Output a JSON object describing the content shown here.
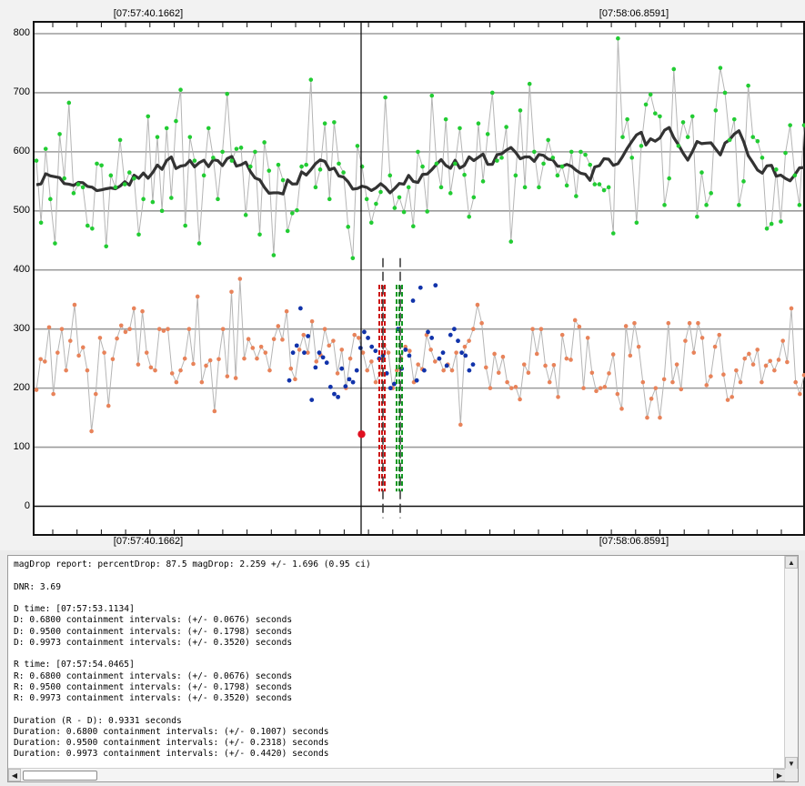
{
  "plot": {
    "top_left_time": "[07:57:40.1662]",
    "top_right_time": "[07:58:06.8591]",
    "bottom_left_time": "[07:57:40.1662]",
    "bottom_right_time": "[07:58:06.8591]",
    "yticks": [
      "800",
      "700",
      "600",
      "500",
      "400",
      "300",
      "200",
      "100",
      "0"
    ],
    "colors": {
      "comparison_points": "#22cc33",
      "target_points": "#e8835a",
      "selected_points": "#1133aa",
      "smooth_curve": "#333333",
      "trace_line": "#b5b5b5",
      "d_marker": "#cc1111",
      "r_marker": "#119922",
      "cursor_point": "#e01020"
    }
  },
  "chart_data": {
    "type": "scatter",
    "ylim": [
      0,
      800
    ],
    "grid": true,
    "series": [
      {
        "name": "",
        "values": [
          585,
          480,
          605,
          520,
          445,
          630,
          555,
          683,
          530,
          545,
          540,
          475,
          470,
          580,
          577,
          440,
          560,
          540,
          620,
          545,
          565,
          555,
          460,
          520,
          660,
          515,
          625,
          500,
          640,
          522,
          652,
          705,
          475,
          625,
          585,
          445,
          560,
          640,
          590,
          520,
          600,
          698,
          585,
          605,
          607,
          493,
          575,
          600,
          460,
          616,
          568,
          425,
          578,
          552,
          466,
          496,
          501,
          575,
          578,
          722,
          540,
          570,
          648,
          520,
          650,
          580,
          565,
          473,
          420,
          610,
          575,
          520,
          480,
          512,
          532,
          692,
          560,
          505,
          523,
          498,
          540,
          474,
          600,
          575,
          499,
          695,
          580,
          540,
          655,
          530,
          580,
          640,
          561,
          490,
          523,
          648,
          550,
          630,
          700,
          585,
          590,
          642,
          448,
          560,
          670,
          540,
          715,
          600,
          540,
          580,
          620,
          590,
          560,
          575,
          543,
          600,
          525,
          600,
          595,
          578,
          545,
          545,
          535,
          540,
          462,
          792,
          625,
          655,
          590,
          480,
          610,
          680,
          697,
          665,
          660,
          510,
          555,
          740,
          610,
          650,
          625,
          660,
          490,
          565,
          510,
          530,
          670,
          742,
          700,
          620,
          655,
          510,
          550,
          712,
          625,
          618,
          590,
          470,
          478,
          570,
          482,
          598,
          645,
          560,
          510,
          645
        ]
      },
      {
        "name": "",
        "values": [
          197,
          249,
          245,
          303,
          190,
          260,
          300,
          230,
          280,
          341,
          255,
          269,
          230,
          127,
          190,
          285,
          260,
          170,
          249,
          284,
          306,
          295,
          300,
          335,
          240,
          330,
          260,
          235,
          230,
          300,
          297,
          300,
          225,
          210,
          230,
          250,
          300,
          241,
          355,
          210,
          238,
          247,
          161,
          249,
          300,
          220,
          363,
          217,
          385,
          250,
          283,
          268,
          250,
          270,
          260,
          230,
          283,
          305,
          282,
          330,
          233,
          215,
          265,
          290,
          260,
          313,
          245,
          256,
          300,
          272,
          280,
          225,
          265,
          200,
          250,
          290,
          285,
          260,
          230,
          245,
          210,
          225,
          273,
          260,
          200,
          230,
          250,
          270,
          263,
          210,
          240,
          232,
          290,
          265,
          245,
          250,
          230,
          240,
          230,
          260,
          138,
          270,
          280,
          300,
          341,
          310,
          235,
          200,
          258,
          226,
          253,
          210,
          200,
          202,
          181,
          240,
          226,
          300,
          258,
          300,
          238,
          210,
          239,
          185,
          290,
          250,
          248,
          315,
          304,
          200,
          285,
          226,
          195,
          200,
          202,
          225,
          257,
          190,
          165,
          305,
          255,
          310,
          270,
          210,
          150,
          182,
          200,
          150,
          215,
          310,
          210,
          240,
          198,
          280,
          310,
          260,
          310,
          285,
          205,
          220,
          270,
          290,
          223,
          180,
          185,
          230,
          210,
          250,
          258,
          240,
          265,
          210,
          238,
          246,
          230,
          248,
          280,
          244,
          335,
          210,
          190,
          222
        ]
      },
      {
        "name": "",
        "values": [
          213,
          260,
          272,
          335,
          260,
          288,
          180,
          235,
          260,
          252,
          243,
          202,
          190,
          185,
          233,
          203,
          215,
          210,
          230,
          268,
          295,
          285,
          270,
          263,
          250,
          255,
          225,
          200,
          207,
          300,
          233,
          265,
          255,
          348,
          213,
          370,
          230,
          295,
          285,
          374,
          250,
          260,
          238,
          290,
          300,
          280,
          260,
          255,
          230,
          240
        ]
      }
    ]
  },
  "report": {
    "lines": [
      "magDrop report: percentDrop: 87.5 magDrop: 2.259 +/- 1.696 (0.95 ci)",
      "",
      "DNR: 3.69",
      "",
      "D time: [07:57:53.1134]",
      "D: 0.6800 containment intervals: (+/- 0.0676) seconds",
      "D: 0.9500 containment intervals: (+/- 0.1798) seconds",
      "D: 0.9973 containment intervals: (+/- 0.3520) seconds",
      "",
      "R time: [07:57:54.0465]",
      "R: 0.6800 containment intervals: (+/- 0.0676) seconds",
      "R: 0.9500 containment intervals: (+/- 0.1798) seconds",
      "R: 0.9973 containment intervals: (+/- 0.3520) seconds",
      "",
      "Duration (R - D): 0.9331 seconds",
      "Duration: 0.6800 containment intervals: (+/- 0.1007) seconds",
      "Duration: 0.9500 containment intervals: (+/- 0.2318) seconds",
      "Duration: 0.9973 containment intervals: (+/- 0.4420) seconds"
    ]
  },
  "scrollbars": {
    "up_arrow": "▲",
    "down_arrow": "▼",
    "left_arrow": "◀",
    "right_arrow": "▶"
  }
}
